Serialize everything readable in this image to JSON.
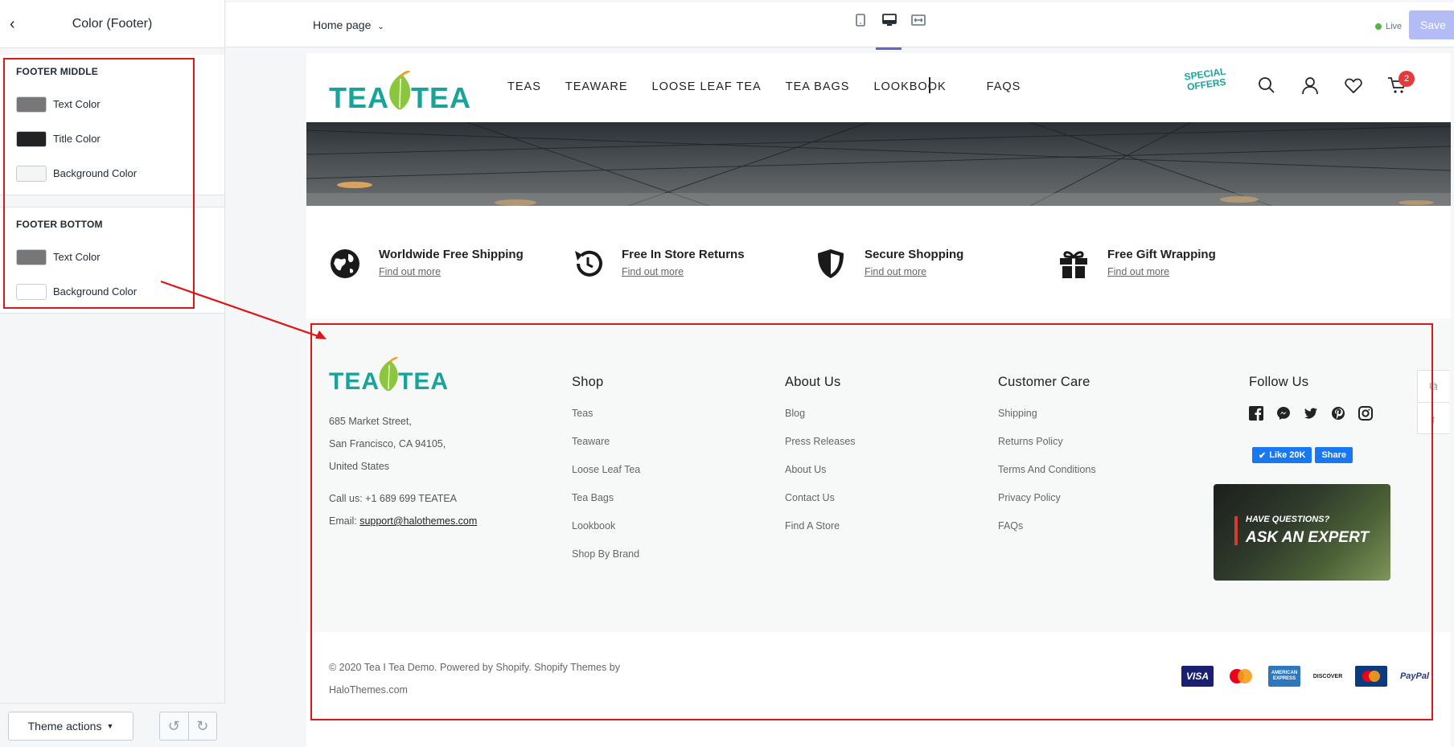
{
  "editor": {
    "sidebar_title": "Color (Footer)",
    "footer_middle": {
      "title": "FOOTER MIDDLE",
      "items": [
        {
          "label": "Text Color",
          "color": "#7a7a7a"
        },
        {
          "label": "Title Color",
          "color": "#222222"
        },
        {
          "label": "Background Color",
          "color": "#f7f8f8"
        }
      ]
    },
    "footer_bottom": {
      "title": "FOOTER BOTTOM",
      "items": [
        {
          "label": "Text Color",
          "color": "#7a7a7a"
        },
        {
          "label": "Background Color",
          "color": "#ffffff"
        }
      ]
    },
    "theme_actions_label": "Theme actions",
    "page_selector": "Home page",
    "live_label": "Live",
    "save_label": "Save"
  },
  "store": {
    "logo_text": "TEA TEA",
    "nav": [
      "TEAS",
      "TEAWARE",
      "LOOSE LEAF TEA",
      "TEA BAGS",
      "LOOKBOOK",
      "FAQS"
    ],
    "special_offers": "SPECIAL OFFERS",
    "cart_count": "2",
    "services": [
      {
        "title": "Worldwide Free Shipping",
        "link": "Find out more",
        "icon": "globe-icon"
      },
      {
        "title": "Free In Store Returns",
        "link": "Find out more",
        "icon": "return-icon"
      },
      {
        "title": "Secure Shopping",
        "link": "Find out more",
        "icon": "shield-icon"
      },
      {
        "title": "Free Gift Wrapping",
        "link": "Find out more",
        "icon": "gift-icon"
      }
    ],
    "footer": {
      "address": [
        "685 Market Street,",
        "San Francisco, CA 94105,",
        "United States"
      ],
      "call": "Call us: +1 689 699 TEATEA",
      "email_label": "Email: ",
      "email": "support@halothemes.com",
      "columns": [
        {
          "title": "Shop",
          "links": [
            "Teas",
            "Teaware",
            "Loose Leaf Tea",
            "Tea Bags",
            "Lookbook",
            "Shop By Brand"
          ]
        },
        {
          "title": "About Us",
          "links": [
            "Blog",
            "Press Releases",
            "About Us",
            "Contact Us",
            "Find A Store"
          ]
        },
        {
          "title": "Customer Care",
          "links": [
            "Shipping",
            "Returns Policy",
            "Terms And Conditions",
            "Privacy Policy",
            "FAQs"
          ]
        }
      ],
      "follow_title": "Follow Us",
      "social": [
        "facebook-icon",
        "messenger-icon",
        "twitter-icon",
        "pinterest-icon",
        "instagram-icon"
      ],
      "fb_like": "Like 20K",
      "fb_share": "Share",
      "expert_question": "HAVE QUESTIONS?",
      "expert_title": "ASK AN EXPERT",
      "copyright": "© 2020 Tea I Tea Demo. Powered by Shopify. Shopify Themes by HaloThemes.com",
      "payments": [
        "VISA",
        "mastercard",
        "AMERICAN EXPRESS",
        "DISCOVER",
        "maestro",
        "PayPal"
      ]
    }
  }
}
